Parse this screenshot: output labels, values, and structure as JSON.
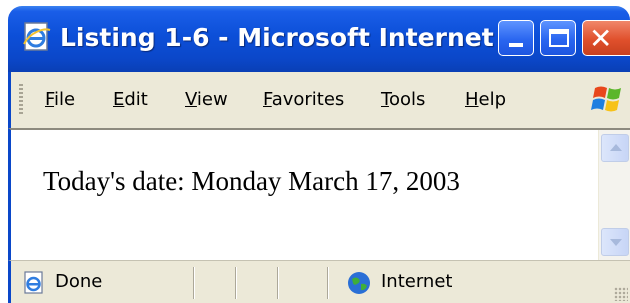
{
  "window": {
    "title": "Listing 1-6 - Microsoft Internet ..."
  },
  "menu": {
    "items": [
      {
        "label": "File"
      },
      {
        "label": "Edit"
      },
      {
        "label": "View"
      },
      {
        "label": "Favorites"
      },
      {
        "label": "Tools"
      },
      {
        "label": "Help"
      }
    ]
  },
  "page": {
    "body_text": "Today's date: Monday March 17, 2003"
  },
  "status": {
    "text": "Done",
    "zone": "Internet"
  },
  "colors": {
    "title_bar": "#0c4fd8",
    "close_button": "#e0502c",
    "chrome": "#ece9d8",
    "content_bg": "#ffffff"
  },
  "icons": {
    "title": "ie-page-icon",
    "minimize": "minimize-icon",
    "maximize": "maximize-icon",
    "close": "close-icon",
    "brand": "windows-logo-icon",
    "status": "ie-page-icon",
    "zone": "globe-icon"
  }
}
